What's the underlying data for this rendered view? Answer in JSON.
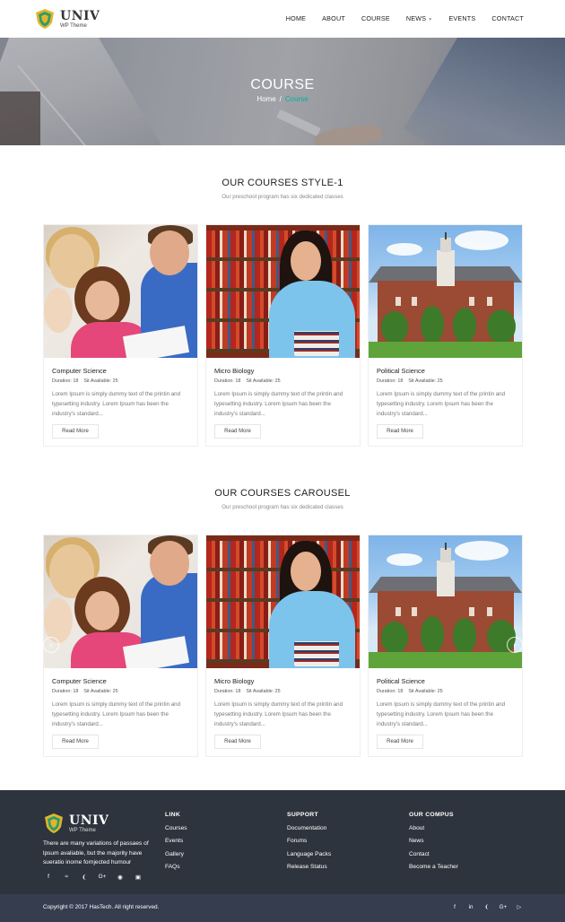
{
  "brand": {
    "name": "UNIV",
    "tagline": "WP Theme",
    "accent": "#00b3a0",
    "shield_color": "#e1b52b",
    "shield_inner": "#2f9a6a"
  },
  "nav": {
    "items": [
      {
        "label": "HOME"
      },
      {
        "label": "ABOUT"
      },
      {
        "label": "COURSE"
      },
      {
        "label": "NEWS",
        "has_dropdown": true
      },
      {
        "label": "EVENTS"
      },
      {
        "label": "CONTACT"
      }
    ]
  },
  "hero": {
    "title": "COURSE",
    "breadcrumb_home": "Home",
    "breadcrumb_sep": "/",
    "breadcrumb_current": "Course"
  },
  "section1": {
    "title": "OUR COURSES STYLE-1",
    "subtitle": "Our preschool program has six dedicated classes"
  },
  "section2": {
    "title": "OUR COURSES CAROUSEL",
    "subtitle": "Our preschool program has six dedicated classes"
  },
  "cards": [
    {
      "title": "Computer Science",
      "duration": "Duration: 18",
      "seats": "Sit Available: 25",
      "desc": "Lorem Ipsum is simply dummy text of the printin and typesetting industry. Lorem Ipsum has been the industry's standard...",
      "button": "Read More"
    },
    {
      "title": "Micro Biology",
      "duration": "Duration: 18",
      "seats": "Sit Available: 25",
      "desc": "Lorem Ipsum is simply dummy text of the printin and typesetting industry. Lorem Ipsum has been the industry's standard...",
      "button": "Read More"
    },
    {
      "title": "Political Science",
      "duration": "Duration: 18",
      "seats": "Sit Available: 25",
      "desc": "Lorem Ipsum is simply dummy text of the printin and typesetting industry. Lorem Ipsum has been the industry's standard...",
      "button": "Read More"
    }
  ],
  "carousel": {
    "prev_icon": "chevron-left-icon",
    "next_icon": "chevron-right-icon"
  },
  "footer": {
    "about": "There are many variations of passaes of lpsum avaliable, but the majority have sueratio inome fornjected humour",
    "social": [
      "facebook-icon",
      "rss-icon",
      "twitter-icon",
      "google-plus-icon",
      "pinterest-icon",
      "instagram-icon"
    ],
    "columns": [
      {
        "heading": "LINK",
        "links": [
          "Courses",
          "Events",
          "Gallery",
          "FAQs"
        ]
      },
      {
        "heading": "SUPPORT",
        "links": [
          "Documentation",
          "Forums",
          "Language Packs",
          "Release Status"
        ]
      },
      {
        "heading": "OUR COMPUS",
        "links": [
          "About",
          "News",
          "Contact",
          "Become a Teacher"
        ]
      }
    ],
    "copyright": "Copyright © 2017 HasTech. All right reserved.",
    "bottom_social": [
      "facebook-icon",
      "linkedin-icon",
      "twitter-icon",
      "google-plus-icon",
      "youtube-icon"
    ]
  }
}
